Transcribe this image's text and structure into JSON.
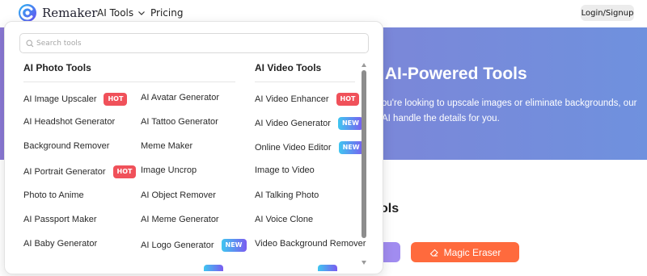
{
  "header": {
    "brand": "Remaker",
    "nav_tools": "AI Tools",
    "nav_pricing": "Pricing",
    "login": "Login/Signup"
  },
  "hero": {
    "title": "n AI-Powered Tools",
    "line1": "ou're looking to upscale images or eliminate backgrounds, our",
    "line2": "AI handle the details for you."
  },
  "section": {
    "title": "ols",
    "magic_button": "Magic Eraser"
  },
  "dropdown": {
    "search_placeholder": "Search tools",
    "photo_heading": "AI Photo Tools",
    "video_heading": "AI Video Tools",
    "photo_col1": [
      {
        "label": "AI Image Upscaler",
        "badge": "HOT"
      },
      {
        "label": "AI Headshot Generator",
        "badge": ""
      },
      {
        "label": "Background Remover",
        "badge": ""
      },
      {
        "label": "AI Portrait Generator",
        "badge": "HOT"
      },
      {
        "label": "Photo to Anime",
        "badge": ""
      },
      {
        "label": "AI Passport Maker",
        "badge": ""
      },
      {
        "label": "AI Baby Generator",
        "badge": ""
      }
    ],
    "photo_col2": [
      {
        "label": "AI Avatar Generator",
        "badge": ""
      },
      {
        "label": "AI Tattoo Generator",
        "badge": ""
      },
      {
        "label": "Meme Maker",
        "badge": ""
      },
      {
        "label": "Image Uncrop",
        "badge": ""
      },
      {
        "label": "AI Object Remover",
        "badge": ""
      },
      {
        "label": "AI Meme Generator",
        "badge": ""
      },
      {
        "label": "AI Logo Generator",
        "badge": "NEW"
      }
    ],
    "video_col": [
      {
        "label": "AI Video Enhancer",
        "badge": "HOT"
      },
      {
        "label": "AI Video Generator",
        "badge": "NEW"
      },
      {
        "label": "Online Video Editor",
        "badge": "NEW"
      },
      {
        "label": "Image to Video",
        "badge": ""
      },
      {
        "label": "AI Talking Photo",
        "badge": ""
      },
      {
        "label": "AI Voice Clone",
        "badge": ""
      },
      {
        "label": "Video Background Remover",
        "badge": ""
      }
    ]
  },
  "colors": {
    "hot": "#f0515a",
    "magic_eraser": "#ff6a3d",
    "hero": "#8a78d4"
  }
}
